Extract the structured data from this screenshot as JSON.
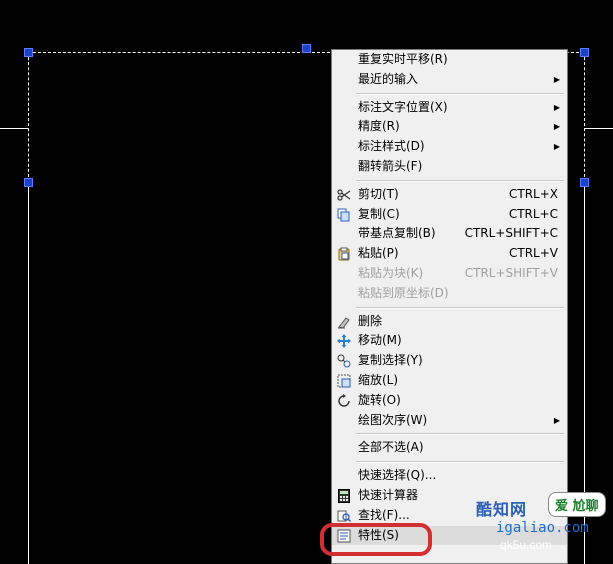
{
  "colors": {
    "canvas": "#000000",
    "menu_bg": "#f0f0f0",
    "grip": "#1a44c8",
    "highlight": "#d23030"
  },
  "menu": {
    "items": [
      {
        "label": "重复实时平移(R)",
        "shortcut": "",
        "submenu": false,
        "disabled": false,
        "icon": ""
      },
      {
        "label": "最近的输入",
        "shortcut": "",
        "submenu": true,
        "disabled": false,
        "icon": ""
      },
      {
        "label": "标注文字位置(X)",
        "shortcut": "",
        "submenu": true,
        "disabled": false,
        "icon": ""
      },
      {
        "label": "精度(R)",
        "shortcut": "",
        "submenu": true,
        "disabled": false,
        "icon": ""
      },
      {
        "label": "标注样式(D)",
        "shortcut": "",
        "submenu": true,
        "disabled": false,
        "icon": ""
      },
      {
        "label": "翻转箭头(F)",
        "shortcut": "",
        "submenu": false,
        "disabled": false,
        "icon": ""
      },
      {
        "label": "剪切(T)",
        "shortcut": "CTRL+X",
        "submenu": false,
        "disabled": false,
        "icon": "scissors-icon"
      },
      {
        "label": "复制(C)",
        "shortcut": "CTRL+C",
        "submenu": false,
        "disabled": false,
        "icon": "copy-icon"
      },
      {
        "label": "带基点复制(B)",
        "shortcut": "CTRL+SHIFT+C",
        "submenu": false,
        "disabled": false,
        "icon": ""
      },
      {
        "label": "粘贴(P)",
        "shortcut": "CTRL+V",
        "submenu": false,
        "disabled": false,
        "icon": "paste-icon"
      },
      {
        "label": "粘贴为块(K)",
        "shortcut": "CTRL+SHIFT+V",
        "submenu": false,
        "disabled": true,
        "icon": ""
      },
      {
        "label": "粘贴到原坐标(D)",
        "shortcut": "",
        "submenu": false,
        "disabled": true,
        "icon": ""
      },
      {
        "label": "删除",
        "shortcut": "",
        "submenu": false,
        "disabled": false,
        "icon": "eraser-icon"
      },
      {
        "label": "移动(M)",
        "shortcut": "",
        "submenu": false,
        "disabled": false,
        "icon": "move-icon"
      },
      {
        "label": "复制选择(Y)",
        "shortcut": "",
        "submenu": false,
        "disabled": false,
        "icon": "copy-select-icon"
      },
      {
        "label": "缩放(L)",
        "shortcut": "",
        "submenu": false,
        "disabled": false,
        "icon": "scale-icon"
      },
      {
        "label": "旋转(O)",
        "shortcut": "",
        "submenu": false,
        "disabled": false,
        "icon": "rotate-icon"
      },
      {
        "label": "绘图次序(W)",
        "shortcut": "",
        "submenu": true,
        "disabled": false,
        "icon": ""
      },
      {
        "label": "全部不选(A)",
        "shortcut": "",
        "submenu": false,
        "disabled": false,
        "icon": ""
      },
      {
        "label": "快速选择(Q)...",
        "shortcut": "",
        "submenu": false,
        "disabled": false,
        "icon": ""
      },
      {
        "label": "快速计算器",
        "shortcut": "",
        "submenu": false,
        "disabled": false,
        "icon": "calculator-icon"
      },
      {
        "label": "查找(F)...",
        "shortcut": "",
        "submenu": false,
        "disabled": false,
        "icon": "find-icon"
      },
      {
        "label": "特性(S)",
        "shortcut": "",
        "submenu": false,
        "disabled": false,
        "icon": "properties-icon"
      }
    ]
  },
  "watermark": {
    "line1": "酷知网",
    "badge": "爱 尬聊",
    "line2": "igaliao.com",
    "line3": "qk5u.com"
  }
}
